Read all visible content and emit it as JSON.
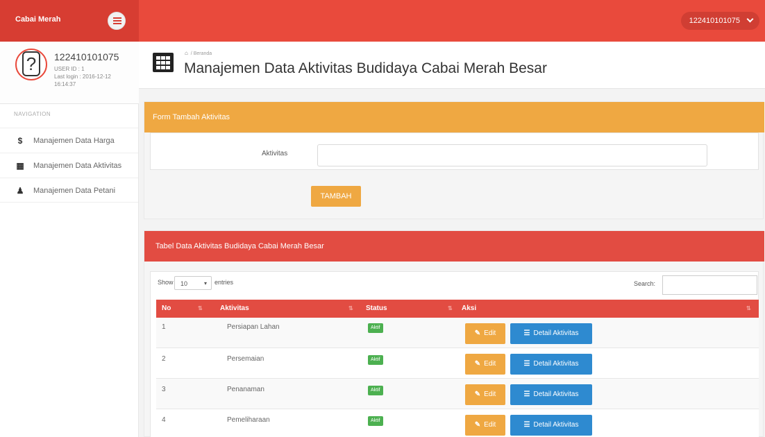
{
  "app": {
    "brand": "Cabai Merah",
    "user_pill": "122410101075"
  },
  "profile": {
    "name": "122410101075",
    "user_id": "USER ID : 1",
    "last_login": "Last login : 2016-12-12 16:14:37",
    "avatar_glyph": "?"
  },
  "sidebar": {
    "heading": "NAVIGATION",
    "items": [
      {
        "icon": "dollar-icon",
        "glyph": "$",
        "label": "Manajemen Data Harga"
      },
      {
        "icon": "grid-icon",
        "glyph": "▦",
        "label": "Manajemen Data Aktivitas"
      },
      {
        "icon": "user-icon",
        "glyph": "♟",
        "label": "Manajemen Data Petani"
      }
    ]
  },
  "header": {
    "breadcrumb": "Beranda",
    "title": "Manajemen Data Aktivitas Budidaya Cabai Merah Besar"
  },
  "form": {
    "heading": "Form Tambah Aktivitas",
    "label": "Aktivitas",
    "value": "",
    "placeholder": "",
    "submit": "TAMBAH"
  },
  "table": {
    "heading": "Tabel Data Aktivitas Budidaya Cabai Merah Besar",
    "show_label": "Show",
    "entries_value": "10",
    "entries_label": "entries",
    "search_label": "Search:",
    "columns": [
      "No",
      "Aktivitas",
      "Status",
      "Aksi"
    ],
    "edit_label": "Edit",
    "detail_label": "Detail Aktivitas",
    "rows": [
      {
        "no": "1",
        "aktivitas": "Persiapan Lahan",
        "status": "Aktif"
      },
      {
        "no": "2",
        "aktivitas": "Persemaian",
        "status": "Aktif"
      },
      {
        "no": "3",
        "aktivitas": "Penanaman",
        "status": "Aktif"
      },
      {
        "no": "4",
        "aktivitas": "Pemeliharaan",
        "status": "Aktif"
      }
    ]
  },
  "colors": {
    "brand_dark": "#d73d32",
    "navbar": "#e94a3c",
    "warning": "#efa842",
    "danger": "#e24c42",
    "success": "#4cb050",
    "primary": "#2e8ad0"
  }
}
